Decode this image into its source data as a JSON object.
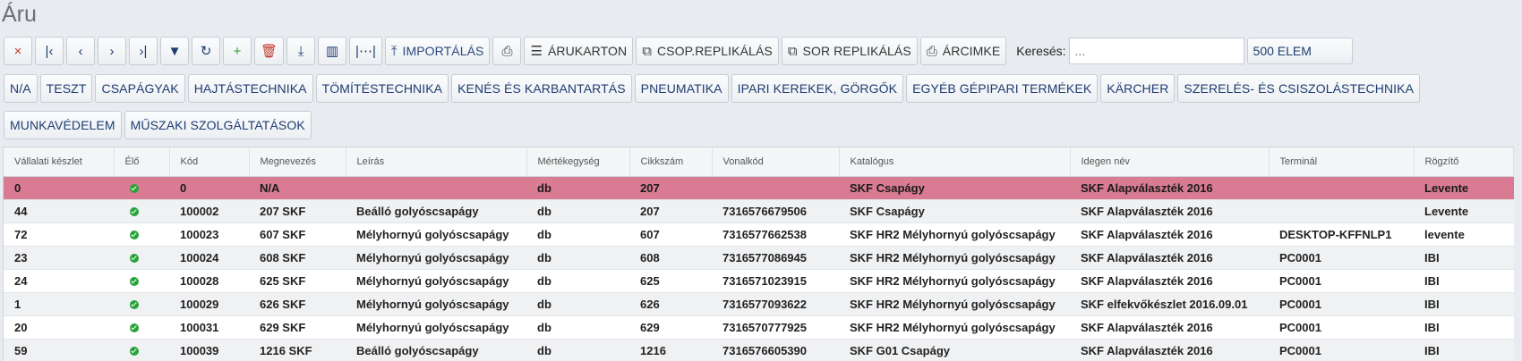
{
  "page": {
    "title": "Áru"
  },
  "toolbar": {
    "buttons": [
      {
        "name": "close-button",
        "icon": "×",
        "label": "",
        "color": "red"
      },
      {
        "name": "first-record-button",
        "icon": "|‹",
        "label": "",
        "color": "navy"
      },
      {
        "name": "prev-record-button",
        "icon": "‹",
        "label": "",
        "color": "navy"
      },
      {
        "name": "next-record-button",
        "icon": "›",
        "label": "",
        "color": "navy"
      },
      {
        "name": "last-record-button",
        "icon": "›|",
        "label": "",
        "color": "navy"
      },
      {
        "name": "filter-button",
        "icon": "▼",
        "label": "",
        "color": "navy"
      },
      {
        "name": "refresh-button",
        "icon": "↻",
        "label": "",
        "color": "navy"
      },
      {
        "name": "add-button",
        "icon": "+",
        "label": "",
        "color": "green"
      },
      {
        "name": "delete-button",
        "icon": "🗑",
        "label": "",
        "color": "red"
      },
      {
        "name": "download-button",
        "icon": "⤓",
        "label": "",
        "color": "navy"
      },
      {
        "name": "columns-button",
        "icon": "▥",
        "label": "",
        "color": "navy"
      },
      {
        "name": "column-width-button",
        "icon": "|⋯|",
        "label": "",
        "color": "navy"
      },
      {
        "name": "import-button",
        "icon": "⤒",
        "label": "IMPORTÁLÁS",
        "color": "navy"
      },
      {
        "name": "print-button",
        "icon": "⎙",
        "label": "",
        "color": "dark"
      },
      {
        "name": "product-card-button",
        "icon": "☰",
        "label": "ÁRUKARTON",
        "color": "dark"
      },
      {
        "name": "group-replicate-button",
        "icon": "⧉",
        "label": "CSOP.REPLIKÁLÁS",
        "color": "dark"
      },
      {
        "name": "row-replicate-button",
        "icon": "⧉",
        "label": "SOR REPLIKÁLÁS",
        "color": "dark"
      },
      {
        "name": "price-label-button",
        "icon": "⎙",
        "label": "ÁRCIMKE",
        "color": "dark"
      }
    ],
    "search_label": "Keresés:",
    "search_placeholder": "...",
    "page_size": "500 ELEM"
  },
  "categories": [
    "N/A",
    "TESZT",
    "CSAPÁGYAK",
    "HAJTÁSTECHNIKA",
    "TÖMÍTÉSTECHNIKA",
    "KENÉS ÉS KARBANTARTÁS",
    "PNEUMATIKA",
    "IPARI KEREKEK, GÖRGŐK",
    "EGYÉB GÉPIPARI TERMÉKEK",
    "KÄRCHER",
    "SZERELÉS- ÉS CSISZOLÁSTECHNIKA",
    "MUNKAVÉDELEM",
    "MŰSZAKI SZOLGÁLTATÁSOK"
  ],
  "table": {
    "columns": [
      "Vállalati készlet",
      "Élő",
      "Kód",
      "Megnevezés",
      "Leírás",
      "Mértékegység",
      "Cikkszám",
      "Vonalkód",
      "Katalógus",
      "Idegen név",
      "Terminál",
      "Rögzítő"
    ],
    "rows": [
      [
        "0",
        "",
        "0",
        "N/A",
        "",
        "db",
        "207",
        "",
        "SKF Csapágy",
        "SKF Alapválaszték 2016",
        "",
        "Levente"
      ],
      [
        "44",
        "",
        "100002",
        "207 SKF",
        "Beálló golyóscsapágy",
        "db",
        "207",
        "7316576679506",
        "SKF Csapágy",
        "SKF Alapválaszték 2016",
        "",
        "Levente"
      ],
      [
        "72",
        "",
        "100023",
        "607 SKF",
        "Mélyhornyú golyóscsapágy",
        "db",
        "607",
        "7316577662538",
        "SKF HR2 Mélyhornyú golyóscsapágy",
        "SKF Alapválaszték 2016",
        "DESKTOP-KFFNLP1",
        "levente"
      ],
      [
        "23",
        "",
        "100024",
        "608 SKF",
        "Mélyhornyú golyóscsapágy",
        "db",
        "608",
        "7316577086945",
        "SKF HR2 Mélyhornyú golyóscsapágy",
        "SKF Alapválaszték 2016",
        "PC0001",
        "IBI"
      ],
      [
        "24",
        "",
        "100028",
        "625 SKF",
        "Mélyhornyú golyóscsapágy",
        "db",
        "625",
        "7316571023915",
        "SKF HR2 Mélyhornyú golyóscsapágy",
        "SKF Alapválaszték 2016",
        "PC0001",
        "IBI"
      ],
      [
        "1",
        "",
        "100029",
        "626 SKF",
        "Mélyhornyú golyóscsapágy",
        "db",
        "626",
        "7316577093622",
        "SKF HR2 Mélyhornyú golyóscsapágy",
        "SKF elfekvőkészlet 2016.09.01",
        "PC0001",
        "IBI"
      ],
      [
        "20",
        "",
        "100031",
        "629 SKF",
        "Mélyhornyú golyóscsapágy",
        "db",
        "629",
        "7316570777925",
        "SKF HR2 Mélyhornyú golyóscsapágy",
        "SKF Alapválaszték 2016",
        "PC0001",
        "IBI"
      ],
      [
        "59",
        "",
        "100039",
        "1216 SKF",
        "Beálló golyóscsapágy",
        "db",
        "1216",
        "7316576605390",
        "SKF G01 Csapágy",
        "SKF Alapválaszték 2016",
        "PC0001",
        "IBI"
      ]
    ],
    "selected_row": 0
  }
}
